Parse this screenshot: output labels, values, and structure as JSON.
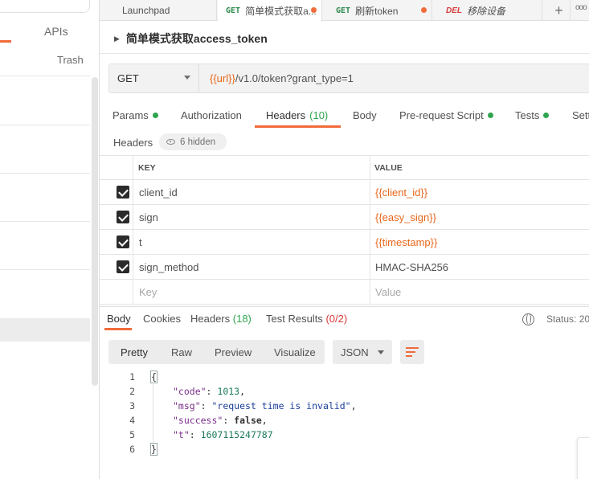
{
  "sidebar": {
    "apis_label": "APIs",
    "trash_label": "Trash"
  },
  "tabs": [
    {
      "label": "Launchpad"
    },
    {
      "method": "GET",
      "label": "简单模式获取a..."
    },
    {
      "method": "GET",
      "label": "刷新token"
    },
    {
      "method": "DEL",
      "label": "移除设备"
    }
  ],
  "tab_more": "ooo",
  "request": {
    "title": "简单模式获取access_token",
    "method": "GET",
    "url_var": "{{url}}",
    "url_rest": "/v1.0/token?grant_type=1"
  },
  "request_tabs": [
    {
      "label": "Params",
      "dot": true
    },
    {
      "label": "Authorization"
    },
    {
      "label": "Headers",
      "count": "(10)",
      "active": true
    },
    {
      "label": "Body"
    },
    {
      "label": "Pre-request Script",
      "dot": true
    },
    {
      "label": "Tests",
      "dot": true
    },
    {
      "label": "Setti"
    }
  ],
  "headers_label": "Headers",
  "hidden_chip": "6 hidden",
  "table": {
    "col_key": "KEY",
    "col_value": "VALUE",
    "rows": [
      {
        "checked": true,
        "key": "client_id",
        "value": "{{client_id}}",
        "is_var": true
      },
      {
        "checked": true,
        "key": "sign",
        "value": "{{easy_sign}}",
        "is_var": true
      },
      {
        "checked": true,
        "key": "t",
        "value": "{{timestamp}}",
        "is_var": true
      },
      {
        "checked": true,
        "key": "sign_method",
        "value": "HMAC-SHA256",
        "is_var": false
      }
    ],
    "placeholder_key": "Key",
    "placeholder_value": "Value"
  },
  "response": {
    "tabs": {
      "body": "Body",
      "cookies": "Cookies",
      "headers": "Headers",
      "headers_count": "(18)",
      "tests": "Test Results",
      "tests_count": "(0/2)"
    },
    "status_label": "Status: 20",
    "view_modes": [
      "Pretty",
      "Raw",
      "Preview",
      "Visualize"
    ],
    "active_view": "Pretty",
    "format": "JSON",
    "code_lines": [
      {
        "n": "1",
        "text": "{"
      },
      {
        "n": "2",
        "key": "\"code\"",
        "value": "1013",
        "type": "num",
        "comma": ","
      },
      {
        "n": "3",
        "key": "\"msg\"",
        "value": "\"request time is invalid\"",
        "type": "str",
        "comma": ","
      },
      {
        "n": "4",
        "key": "\"success\"",
        "value": "false",
        "type": "bool",
        "comma": ","
      },
      {
        "n": "5",
        "key": "\"t\"",
        "value": "1607115247787",
        "type": "num",
        "comma": ""
      },
      {
        "n": "6",
        "text": "}"
      }
    ]
  },
  "colors": {
    "accent": "#f26b3a",
    "variable": "#e8671b",
    "green": "#2fa44f",
    "red": "#d83a3a"
  }
}
